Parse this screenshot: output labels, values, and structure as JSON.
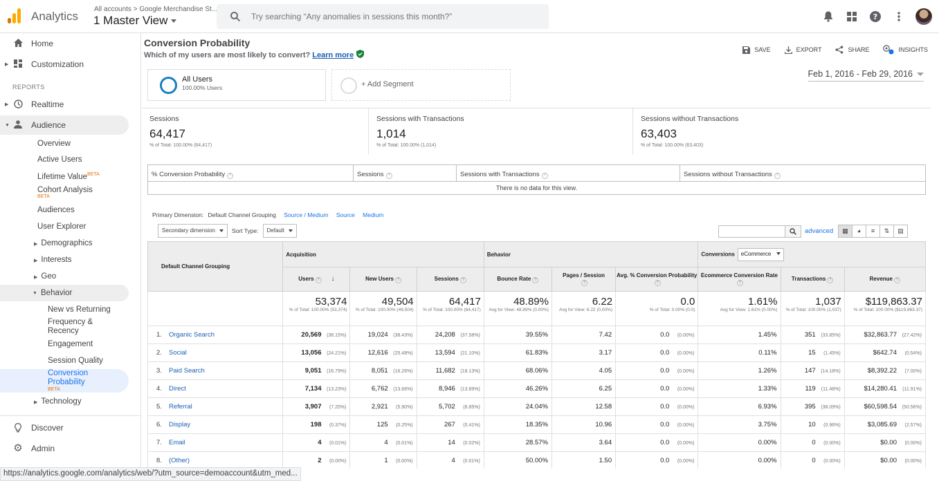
{
  "header": {
    "app_title": "Analytics",
    "account_breadcrumb": "All accounts > Google Merchandise St...",
    "view_name": "1 Master View",
    "search_placeholder": "Try searching “Any anomalies in sessions this month?”",
    "icons": [
      "bell-icon",
      "apps-grid-icon",
      "help-icon",
      "more-vert-icon",
      "avatar"
    ]
  },
  "sidebar": {
    "home": "Home",
    "customization": "Customization",
    "reports_heading": "REPORTS",
    "realtime": "Realtime",
    "audience": "Audience",
    "audience_items": {
      "overview": "Overview",
      "active_users": "Active Users",
      "lifetime_value": "Lifetime Value",
      "lifetime_beta": "BETA",
      "cohort_analysis": "Cohort Analysis",
      "cohort_beta": "BETA",
      "audiences": "Audiences",
      "user_explorer": "User Explorer",
      "demographics": "Demographics",
      "interests": "Interests",
      "geo": "Geo",
      "behavior": "Behavior",
      "new_vs_returning": "New vs Returning",
      "frequency_recency": "Frequency & Recency",
      "engagement": "Engagement",
      "session_quality": "Session Quality",
      "conversion_probability": "Conversion Probability",
      "conversion_beta": "BETA",
      "technology": "Technology"
    },
    "discover": "Discover",
    "admin": "Admin"
  },
  "report": {
    "title": "Conversion Probability",
    "subtitle": "Which of my users are most likely to convert?",
    "learn_more": "Learn more",
    "toolbar": {
      "save": "SAVE",
      "export": "EXPORT",
      "share": "SHARE",
      "insights": "INSIGHTS"
    },
    "segment": {
      "name": "All Users",
      "pct": "100.00% Users",
      "add": "+ Add Segment"
    },
    "date_range": "Feb 1, 2016 - Feb 29, 2016"
  },
  "summary": [
    {
      "label": "Sessions",
      "value": "64,417",
      "sub": "% of Total: 100.00% (64,417)"
    },
    {
      "label": "Sessions with Transactions",
      "value": "1,014",
      "sub": "% of Total: 100.00% (1,014)"
    },
    {
      "label": "Sessions without Transactions",
      "value": "63,403",
      "sub": "% of Total: 100.00% (63,403)"
    }
  ],
  "prob_table": {
    "headers": [
      "% Conversion Probability",
      "Sessions",
      "Sessions with Transactions",
      "Sessions without Transactions"
    ],
    "message": "There is no data for this view."
  },
  "dimensions": {
    "label": "Primary Dimension:",
    "active": "Default Channel Grouping",
    "links": [
      "Source / Medium",
      "Source",
      "Medium"
    ],
    "secondary": "Secondary dimension",
    "sort_label": "Sort Type:",
    "sort_value": "Default",
    "advanced": "advanced"
  },
  "table": {
    "dim_header": "Default Channel Grouping",
    "groups": {
      "acquisition": "Acquisition",
      "behavior": "Behavior",
      "conversions": "Conversions",
      "conversions_select": "eCommerce"
    },
    "columns": [
      "Users",
      "New Users",
      "Sessions",
      "Bounce Rate",
      "Pages / Session",
      "Avg. % Conversion Probability",
      "Ecommerce Conversion Rate",
      "Transactions",
      "Revenue"
    ],
    "totals": [
      {
        "value": "53,374",
        "sub": "% of Total: 100.00% (53,374)"
      },
      {
        "value": "49,504",
        "sub": "% of Total: 100.00% (49,504)"
      },
      {
        "value": "64,417",
        "sub": "% of Total: 100.00% (64,417)"
      },
      {
        "value": "48.89%",
        "sub": "Avg for View: 48.89% (0.00%)"
      },
      {
        "value": "6.22",
        "sub": "Avg for View: 6.22 (0.00%)"
      },
      {
        "value": "0.0",
        "sub": "% of Total: 0.00% (0.0)"
      },
      {
        "value": "1.61%",
        "sub": "Avg for View: 1.61% (0.00%)"
      },
      {
        "value": "1,037",
        "sub": "% of Total: 100.00% (1,037)"
      },
      {
        "value": "$119,863.37",
        "sub": "% of Total: 100.00% ($119,863.37)"
      }
    ],
    "rows": [
      {
        "idx": "1.",
        "channel": "Organic Search",
        "users": "20,569",
        "users_pct": "(38.15%)",
        "new_users": "19,024",
        "new_users_pct": "(38.43%)",
        "sessions": "24,208",
        "sessions_pct": "(37.58%)",
        "bounce": "39.55%",
        "pages": "7.42",
        "conv_prob": "0.0",
        "conv_prob_pct": "(0.00%)",
        "ecr": "1.45%",
        "trans": "351",
        "trans_pct": "(33.85%)",
        "revenue": "$32,863.77",
        "revenue_pct": "(27.42%)"
      },
      {
        "idx": "2.",
        "channel": "Social",
        "users": "13,056",
        "users_pct": "(24.21%)",
        "new_users": "12,616",
        "new_users_pct": "(25.48%)",
        "sessions": "13,594",
        "sessions_pct": "(21.10%)",
        "bounce": "61.83%",
        "pages": "3.17",
        "conv_prob": "0.0",
        "conv_prob_pct": "(0.00%)",
        "ecr": "0.11%",
        "trans": "15",
        "trans_pct": "(1.45%)",
        "revenue": "$642.74",
        "revenue_pct": "(0.54%)"
      },
      {
        "idx": "3.",
        "channel": "Paid Search",
        "users": "9,051",
        "users_pct": "(16.79%)",
        "new_users": "8,051",
        "new_users_pct": "(16.26%)",
        "sessions": "11,682",
        "sessions_pct": "(18.13%)",
        "bounce": "68.06%",
        "pages": "4.05",
        "conv_prob": "0.0",
        "conv_prob_pct": "(0.00%)",
        "ecr": "1.26%",
        "trans": "147",
        "trans_pct": "(14.18%)",
        "revenue": "$8,392.22",
        "revenue_pct": "(7.00%)"
      },
      {
        "idx": "4.",
        "channel": "Direct",
        "users": "7,134",
        "users_pct": "(13.23%)",
        "new_users": "6,762",
        "new_users_pct": "(13.66%)",
        "sessions": "8,946",
        "sessions_pct": "(13.89%)",
        "bounce": "46.26%",
        "pages": "6.25",
        "conv_prob": "0.0",
        "conv_prob_pct": "(0.00%)",
        "ecr": "1.33%",
        "trans": "119",
        "trans_pct": "(11.48%)",
        "revenue": "$14,280.41",
        "revenue_pct": "(11.91%)"
      },
      {
        "idx": "5.",
        "channel": "Referral",
        "users": "3,907",
        "users_pct": "(7.25%)",
        "new_users": "2,921",
        "new_users_pct": "(5.90%)",
        "sessions": "5,702",
        "sessions_pct": "(8.85%)",
        "bounce": "24.04%",
        "pages": "12.58",
        "conv_prob": "0.0",
        "conv_prob_pct": "(0.00%)",
        "ecr": "6.93%",
        "trans": "395",
        "trans_pct": "(38.09%)",
        "revenue": "$60,598.54",
        "revenue_pct": "(50.56%)"
      },
      {
        "idx": "6.",
        "channel": "Display",
        "users": "198",
        "users_pct": "(0.37%)",
        "new_users": "125",
        "new_users_pct": "(0.25%)",
        "sessions": "267",
        "sessions_pct": "(0.41%)",
        "bounce": "18.35%",
        "pages": "10.96",
        "conv_prob": "0.0",
        "conv_prob_pct": "(0.00%)",
        "ecr": "3.75%",
        "trans": "10",
        "trans_pct": "(0.96%)",
        "revenue": "$3,085.69",
        "revenue_pct": "(2.57%)"
      },
      {
        "idx": "7.",
        "channel": "Email",
        "users": "4",
        "users_pct": "(0.01%)",
        "new_users": "4",
        "new_users_pct": "(0.01%)",
        "sessions": "14",
        "sessions_pct": "(0.02%)",
        "bounce": "28.57%",
        "pages": "3.64",
        "conv_prob": "0.0",
        "conv_prob_pct": "(0.00%)",
        "ecr": "0.00%",
        "trans": "0",
        "trans_pct": "(0.00%)",
        "revenue": "$0.00",
        "revenue_pct": "(0.00%)"
      },
      {
        "idx": "8.",
        "channel": "(Other)",
        "users": "2",
        "users_pct": "(0.00%)",
        "new_users": "1",
        "new_users_pct": "(0.00%)",
        "sessions": "4",
        "sessions_pct": "(0.01%)",
        "bounce": "50.00%",
        "pages": "1.50",
        "conv_prob": "0.0",
        "conv_prob_pct": "(0.00%)",
        "ecr": "0.00%",
        "trans": "0",
        "trans_pct": "(0.00%)",
        "revenue": "$0.00",
        "revenue_pct": "(0.00%)"
      }
    ]
  },
  "status_url": "https://analytics.google.com/analytics/web/?utm_source=demoaccount&utm_med..."
}
